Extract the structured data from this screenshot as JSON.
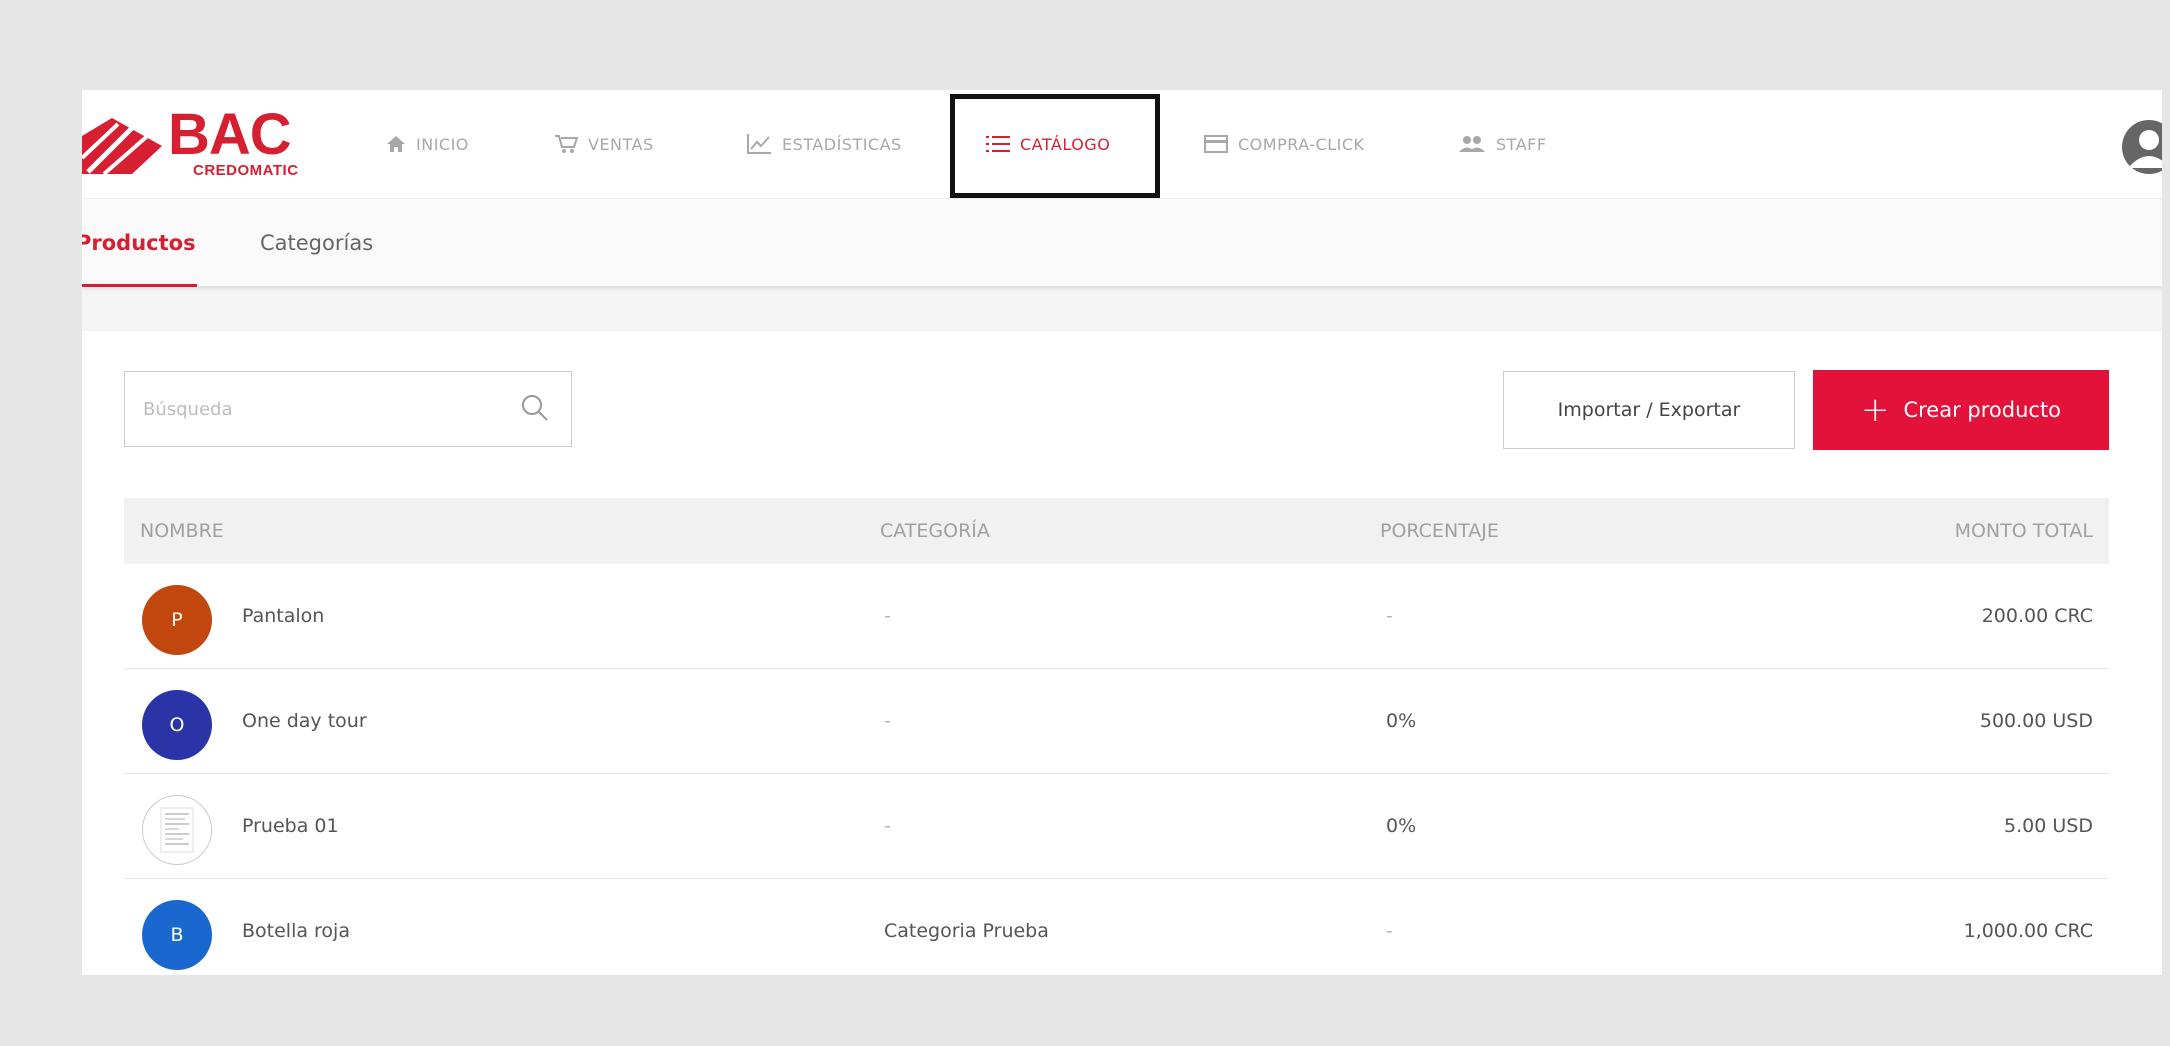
{
  "brand": {
    "name": "BAC",
    "sub": "CREDOMATIC",
    "color": "#d71f32"
  },
  "nav": [
    {
      "id": "inicio",
      "label": "INICIO",
      "icon": "home-icon",
      "active": false
    },
    {
      "id": "ventas",
      "label": "VENTAS",
      "icon": "cart-icon",
      "active": false
    },
    {
      "id": "estadisticas",
      "label": "ESTADÍSTICAS",
      "icon": "chart-icon",
      "active": false
    },
    {
      "id": "catalogo",
      "label": "CATÁLOGO",
      "icon": "list-icon",
      "active": true
    },
    {
      "id": "compra-click",
      "label": "COMPRA-CLICK",
      "icon": "card-icon",
      "active": false
    },
    {
      "id": "staff",
      "label": "STAFF",
      "icon": "people-icon",
      "active": false
    }
  ],
  "subnav": [
    {
      "label": "Productos",
      "active": true
    },
    {
      "label": "Categorías",
      "active": false
    }
  ],
  "search": {
    "placeholder": "Búsqueda",
    "value": ""
  },
  "actions": {
    "import_export": "Importar / Exportar",
    "create_product": "Crear producto",
    "create_color": "#e2123a"
  },
  "table": {
    "headers": {
      "name": "NOMBRE",
      "category": "CATEGORÍA",
      "percentage": "PORCENTAJE",
      "total": "MONTO TOTAL"
    },
    "rows": [
      {
        "initial": "P",
        "avatar_color": "#c2470e",
        "name": "Pantalon",
        "category": "-",
        "percentage": "-",
        "total": "200.00 CRC"
      },
      {
        "initial": "O",
        "avatar_color": "#2a34a6",
        "name": "One day tour",
        "category": "-",
        "percentage": "0%",
        "total": "500.00 USD"
      },
      {
        "initial": "",
        "avatar_color": "#ffffff",
        "name": "Prueba 01",
        "category": "-",
        "percentage": "0%",
        "total": "5.00 USD"
      },
      {
        "initial": "B",
        "avatar_color": "#1a67d0",
        "name": "Botella roja",
        "category": "Categoria Prueba",
        "percentage": "-",
        "total": "1,000.00 CRC"
      }
    ]
  }
}
